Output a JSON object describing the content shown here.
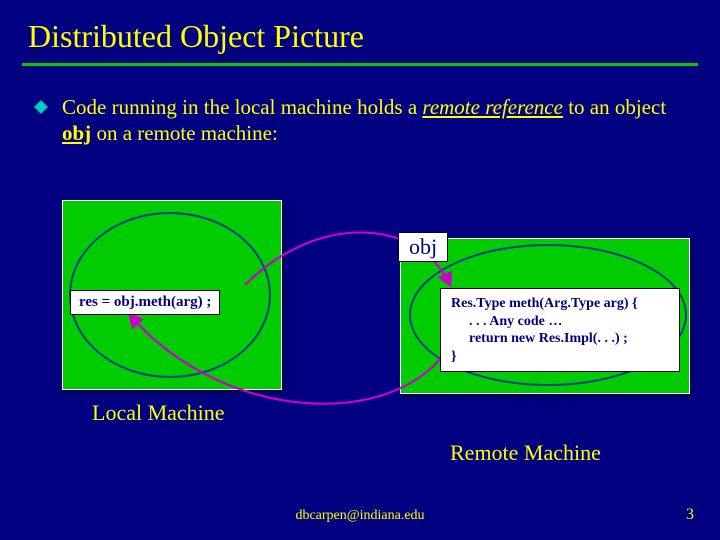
{
  "title": "Distributed Object Picture",
  "bullet": {
    "pre": "Code running in the local machine holds a ",
    "ital": "remote reference",
    "mid": " to an object ",
    "bold": "obj",
    "post": " on a remote machine:"
  },
  "diagram": {
    "obj_label": "obj",
    "local_code": "res = obj.meth(arg) ;",
    "remote_code": {
      "l1": "Res.Type  meth(Arg.Type arg) {",
      "l2": ". . . Any code …",
      "l3": "return new Res.Impl(. . .) ;",
      "l4": "}"
    },
    "local_label": "Local Machine",
    "remote_label": "Remote Machine"
  },
  "footer": {
    "email": "dbcarpen@indiana.edu",
    "page": "3"
  },
  "colors": {
    "bg": "#000080",
    "accent": "#00cc00",
    "text": "#ffff00",
    "arc": "#cc00cc"
  }
}
